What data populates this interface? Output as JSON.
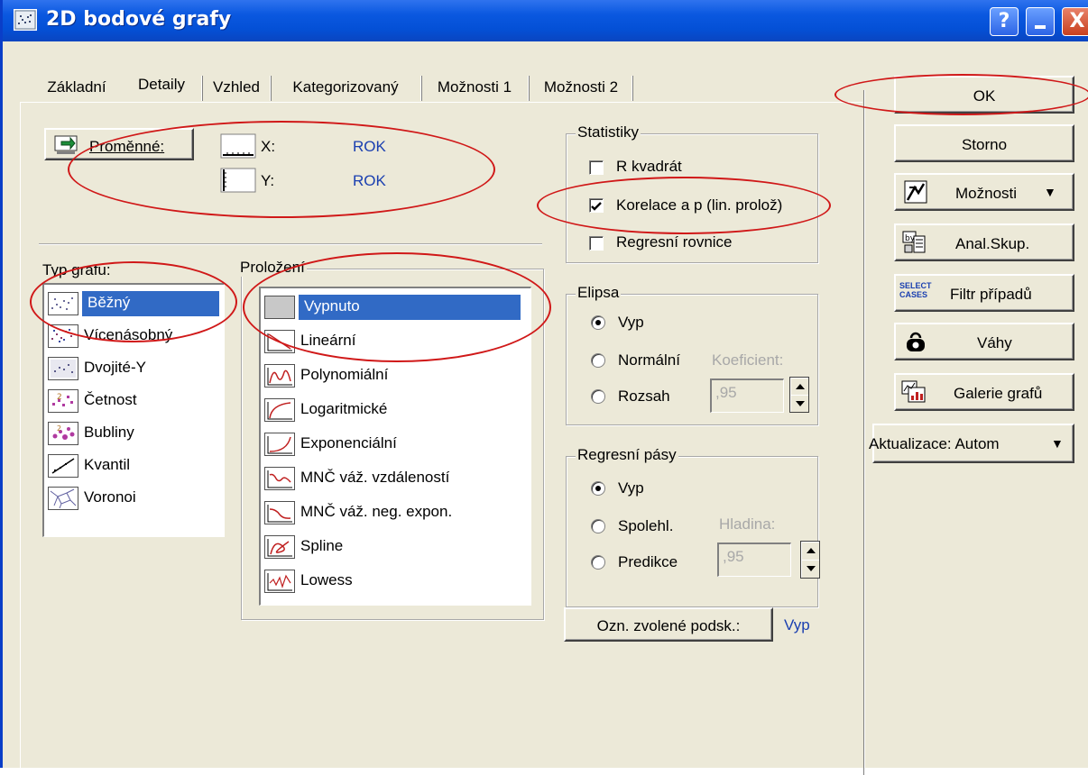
{
  "window": {
    "title": "2D bodové grafy",
    "help_glyph": "?",
    "close_glyph": "X"
  },
  "tabs": [
    {
      "label": "Základní"
    },
    {
      "label": "Detaily"
    },
    {
      "label": "Vzhled"
    },
    {
      "label": "Kategorizovaný"
    },
    {
      "label": "Možnosti 1"
    },
    {
      "label": "Možnosti 2"
    }
  ],
  "variables": {
    "button_label": "Proměnné:",
    "x_label": "X:",
    "x_value": "ROK",
    "y_label": "Y:",
    "y_value": "ROK"
  },
  "graph_type": {
    "legend": "Typ grafu:",
    "items": [
      "Běžný",
      "Vícenásobný",
      "Dvojité-Y",
      "Četnost",
      "Bubliny",
      "Kvantil",
      "Voronoi"
    ],
    "selected": "Běžný"
  },
  "fit": {
    "legend": "Proložení",
    "items": [
      "Vypnuto",
      "Lineární",
      "Polynomiální",
      "Logaritmické",
      "Exponenciální",
      "MNČ váž. vzdáleností",
      "MNČ váž. neg. expon.",
      "Spline",
      "Lowess"
    ],
    "selected": "Vypnuto"
  },
  "statistics": {
    "legend": "Statistiky",
    "options": [
      {
        "label": "R kvadrát",
        "checked": false
      },
      {
        "label": "Korelace a p (lin. prolož)",
        "checked": true
      },
      {
        "label": "Regresní rovnice",
        "checked": false
      }
    ]
  },
  "ellipse": {
    "legend": "Elipsa",
    "options": [
      {
        "label": "Vyp",
        "selected": true
      },
      {
        "label": "Normální",
        "selected": false
      },
      {
        "label": "Rozsah",
        "selected": false
      }
    ],
    "coef_label": "Koeficient:",
    "coef_value": ",95"
  },
  "bands": {
    "legend": "Regresní pásy",
    "options": [
      {
        "label": "Vyp",
        "selected": true
      },
      {
        "label": "Spolehl.",
        "selected": false
      },
      {
        "label": "Predikce",
        "selected": false
      }
    ],
    "level_label": "Hladina:",
    "level_value": ",95"
  },
  "subset": {
    "button_label": "Ozn. zvolené podsk.:",
    "value": "Vyp"
  },
  "right_buttons": {
    "ok": "OK",
    "cancel": "Storno",
    "options": "Možnosti",
    "options_arrow": "▼",
    "anal_group": "Anal.Skup.",
    "select_icon_text": "SELECT CASES",
    "filter": "Filtr případů",
    "weights": "Váhy",
    "gallery": "Galerie grafů",
    "update": "Aktualizace: Autom",
    "update_arrow": "▼"
  },
  "colors": {
    "title_bar": "#0a58e0",
    "selection": "#316ac5",
    "highlight_oval": "#d01818",
    "value_text": "#1a3fb0"
  }
}
